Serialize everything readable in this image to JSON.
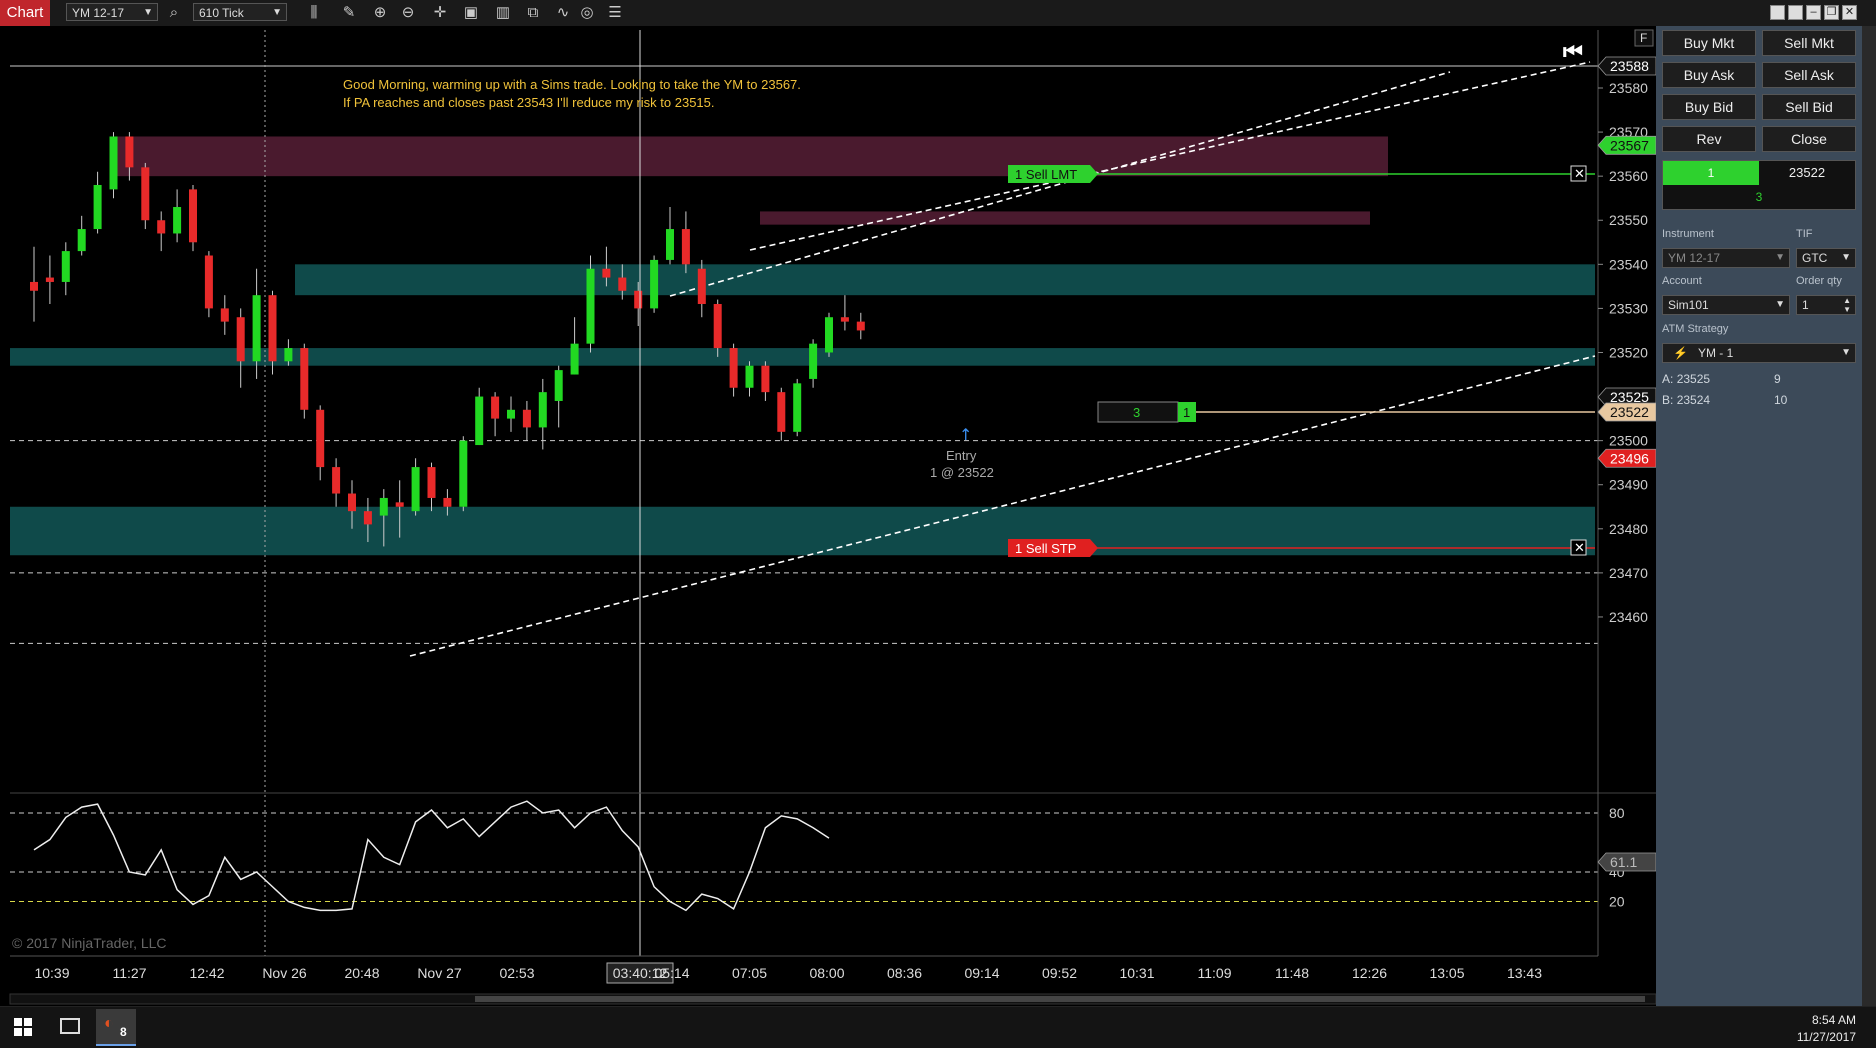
{
  "toolbar": {
    "tab_label": "Chart",
    "instrument": "YM 12-17",
    "interval": "610 Tick"
  },
  "chart": {
    "note_line1": "Good Morning, warming up with a Sims trade. Looking to take the YM to 23567.",
    "note_line2": "If PA reaches and closes past 23543 I'll reduce my risk to 23515.",
    "copyright": "© 2017 NinjaTrader, LLC",
    "f_button": "F",
    "sell_lmt_label": "1  Sell LMT",
    "sell_stp_label": "1  Sell STP",
    "entry_label": "Entry",
    "entry_detail": "1 @ 23522",
    "position_qty": "3",
    "position_side": "1",
    "cursor_time": "03:40:12",
    "price_tags": {
      "top": "23588",
      "target": "23567",
      "last": "23525",
      "entry": "23522",
      "stop": "23496",
      "osc": "61.1"
    },
    "colors": {
      "up_candle": "#22d922",
      "down_candle": "#e82a2a",
      "zone_red": "#4a1a2e",
      "zone_teal": "#0f4a4a",
      "stop_red": "#e02020",
      "target_green": "#2ed12e"
    }
  },
  "chart_data": {
    "type": "candlestick",
    "price_axis": {
      "min": 23452,
      "max": 23592,
      "ticks": [
        23588,
        23580,
        23570,
        23560,
        23550,
        23540,
        23530,
        23520,
        23510,
        23500,
        23490,
        23480,
        23470,
        23460
      ]
    },
    "time_axis": [
      "10:39",
      "11:27",
      "12:42",
      "Nov 26",
      "20:48",
      "Nov 27",
      "02:53",
      "03:40:12",
      "05:14",
      "07:05",
      "08:00",
      "08:36",
      "09:14",
      "09:52",
      "10:31",
      "11:09",
      "11:48",
      "12:26",
      "13:05",
      "13:43"
    ],
    "candles": [
      {
        "o": 23536,
        "c": 23534,
        "h": 23544,
        "l": 23527
      },
      {
        "o": 23537,
        "c": 23536,
        "h": 23542,
        "l": 23531
      },
      {
        "o": 23536,
        "c": 23543,
        "h": 23545,
        "l": 23533
      },
      {
        "o": 23543,
        "c": 23548,
        "h": 23551,
        "l": 23542
      },
      {
        "o": 23548,
        "c": 23558,
        "h": 23561,
        "l": 23547
      },
      {
        "o": 23557,
        "c": 23569,
        "h": 23570,
        "l": 23555
      },
      {
        "o": 23569,
        "c": 23562,
        "h": 23570,
        "l": 23559
      },
      {
        "o": 23562,
        "c": 23550,
        "h": 23563,
        "l": 23548
      },
      {
        "o": 23550,
        "c": 23547,
        "h": 23552,
        "l": 23543
      },
      {
        "o": 23547,
        "c": 23553,
        "h": 23557,
        "l": 23545
      },
      {
        "o": 23557,
        "c": 23545,
        "h": 23558,
        "l": 23543
      },
      {
        "o": 23542,
        "c": 23530,
        "h": 23543,
        "l": 23528
      },
      {
        "o": 23530,
        "c": 23527,
        "h": 23533,
        "l": 23524
      },
      {
        "o": 23528,
        "c": 23518,
        "h": 23530,
        "l": 23512
      },
      {
        "o": 23518,
        "c": 23533,
        "h": 23539,
        "l": 23514
      },
      {
        "o": 23533,
        "c": 23518,
        "h": 23534,
        "l": 23515
      },
      {
        "o": 23518,
        "c": 23521,
        "h": 23523,
        "l": 23517
      },
      {
        "o": 23521,
        "c": 23507,
        "h": 23522,
        "l": 23505
      },
      {
        "o": 23507,
        "c": 23494,
        "h": 23508,
        "l": 23491
      },
      {
        "o": 23494,
        "c": 23488,
        "h": 23496,
        "l": 23485
      },
      {
        "o": 23488,
        "c": 23484,
        "h": 23491,
        "l": 23480
      },
      {
        "o": 23484,
        "c": 23481,
        "h": 23487,
        "l": 23477
      },
      {
        "o": 23483,
        "c": 23487,
        "h": 23489,
        "l": 23476
      },
      {
        "o": 23486,
        "c": 23485,
        "h": 23491,
        "l": 23478
      },
      {
        "o": 23484,
        "c": 23494,
        "h": 23496,
        "l": 23483
      },
      {
        "o": 23494,
        "c": 23487,
        "h": 23495,
        "l": 23484
      },
      {
        "o": 23487,
        "c": 23485,
        "h": 23489,
        "l": 23483
      },
      {
        "o": 23485,
        "c": 23500,
        "h": 23501,
        "l": 23484
      },
      {
        "o": 23499,
        "c": 23510,
        "h": 23512,
        "l": 23499
      },
      {
        "o": 23510,
        "c": 23505,
        "h": 23511,
        "l": 23501
      },
      {
        "o": 23505,
        "c": 23507,
        "h": 23510,
        "l": 23502
      },
      {
        "o": 23507,
        "c": 23503,
        "h": 23509,
        "l": 23500
      },
      {
        "o": 23503,
        "c": 23511,
        "h": 23514,
        "l": 23498
      },
      {
        "o": 23509,
        "c": 23516,
        "h": 23517,
        "l": 23503
      },
      {
        "o": 23515,
        "c": 23522,
        "h": 23528,
        "l": 23515
      },
      {
        "o": 23522,
        "c": 23539,
        "h": 23542,
        "l": 23520
      },
      {
        "o": 23539,
        "c": 23537,
        "h": 23544,
        "l": 23535
      },
      {
        "o": 23537,
        "c": 23534,
        "h": 23540,
        "l": 23532
      },
      {
        "o": 23534,
        "c": 23530,
        "h": 23536,
        "l": 23526
      },
      {
        "o": 23530,
        "c": 23541,
        "h": 23542,
        "l": 23529
      },
      {
        "o": 23541,
        "c": 23548,
        "h": 23553,
        "l": 23540
      },
      {
        "o": 23548,
        "c": 23540,
        "h": 23552,
        "l": 23538
      },
      {
        "o": 23539,
        "c": 23531,
        "h": 23541,
        "l": 23528
      },
      {
        "o": 23531,
        "c": 23521,
        "h": 23532,
        "l": 23519
      },
      {
        "o": 23521,
        "c": 23512,
        "h": 23522,
        "l": 23510
      },
      {
        "o": 23512,
        "c": 23517,
        "h": 23518,
        "l": 23510
      },
      {
        "o": 23517,
        "c": 23511,
        "h": 23518,
        "l": 23509
      },
      {
        "o": 23511,
        "c": 23502,
        "h": 23512,
        "l": 23500
      },
      {
        "o": 23502,
        "c": 23513,
        "h": 23514,
        "l": 23501
      },
      {
        "o": 23514,
        "c": 23522,
        "h": 23523,
        "l": 23512
      },
      {
        "o": 23520,
        "c": 23528,
        "h": 23529,
        "l": 23519
      },
      {
        "o": 23528,
        "c": 23527,
        "h": 23533,
        "l": 23525
      },
      {
        "o": 23527,
        "c": 23525,
        "h": 23529,
        "l": 23523
      }
    ],
    "zones": [
      {
        "from": 23560,
        "to": 23569,
        "color": "red"
      },
      {
        "from": 23549,
        "to": 23552,
        "color": "red"
      },
      {
        "from": 23533,
        "to": 23540,
        "color": "teal"
      },
      {
        "from": 23517,
        "to": 23521,
        "color": "teal"
      },
      {
        "from": 23474,
        "to": 23485,
        "color": "teal"
      }
    ],
    "oscillator": {
      "levels": [
        80,
        40,
        20
      ],
      "last": 61.1,
      "values": [
        55,
        62,
        77,
        84,
        86,
        65,
        40,
        38,
        55,
        28,
        18,
        24,
        50,
        35,
        40,
        30,
        20,
        16,
        14,
        14,
        15,
        62,
        50,
        45,
        74,
        82,
        70,
        76,
        64,
        74,
        84,
        88,
        80,
        82,
        70,
        80,
        84,
        68,
        57,
        30,
        20,
        14,
        25,
        22,
        15,
        40,
        70,
        78,
        76,
        70,
        63
      ]
    }
  },
  "panel": {
    "buttons": {
      "buy_mkt": "Buy Mkt",
      "sell_mkt": "Sell Mkt",
      "buy_ask": "Buy Ask",
      "sell_ask": "Sell Ask",
      "buy_bid": "Buy Bid",
      "sell_bid": "Sell Bid",
      "rev": "Rev",
      "close": "Close"
    },
    "position_qty": "1",
    "position_price": "23522",
    "unrealized": "3",
    "instrument_label": "Instrument",
    "instrument_value": "YM 12-17",
    "tif_label": "TIF",
    "tif_value": "GTC",
    "account_label": "Account",
    "account_value": "Sim101",
    "order_qty_label": "Order qty",
    "order_qty_value": "1",
    "atm_label": "ATM Strategy",
    "atm_value": "YM - 1",
    "ask_prefix": "A:",
    "ask_price": "23525",
    "ask_size": "9",
    "bid_prefix": "B:",
    "bid_price": "23524",
    "bid_size": "10"
  },
  "taskbar": {
    "badge": "8",
    "time": "8:54 AM",
    "date": "11/27/2017"
  }
}
